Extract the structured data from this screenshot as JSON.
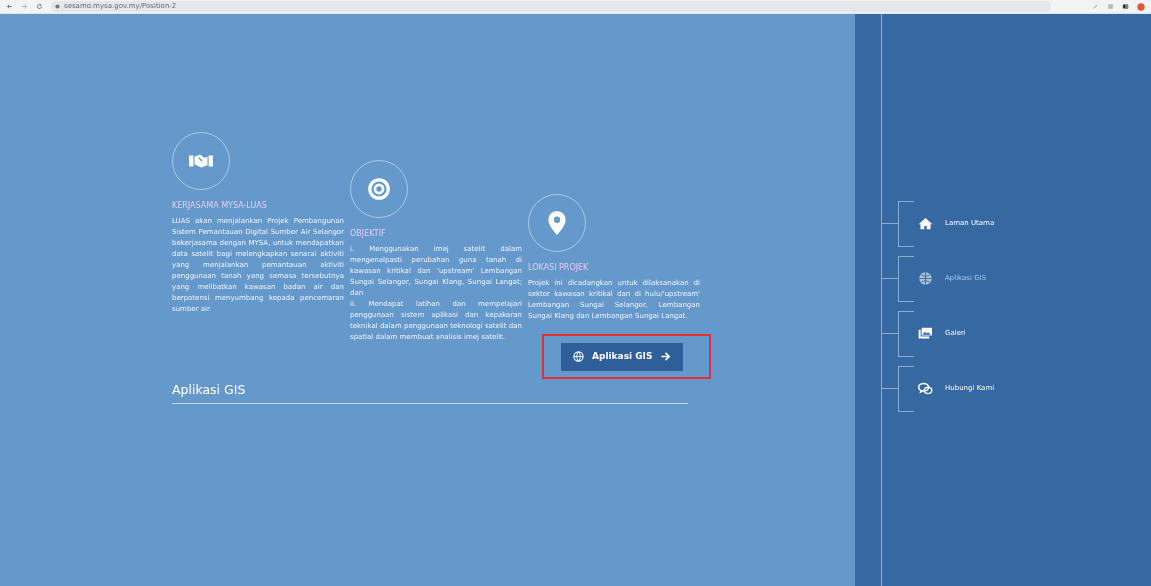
{
  "browser": {
    "url": "sesamo.mysa.gov.my/Position-2"
  },
  "sections": [
    {
      "kind": "handshake",
      "title": "KERJASAMA MYSA-LUAS",
      "paragraphs": [
        "LUAS akan menjalankan Projek Pembangunan Sistem Pemantauan Digital Sumber Air Selangor bekerjasama dengan MYSA, untuk mendapatkan data satelit bagi melengkapkan senarai aktiviti yang menjalankan pemantauan aktiviti penggunaan tanah yang semasa tersebutnya yang melibatkan kawasan badan air dan berpotensi menyumbang kepada pencemaran sumber air."
      ]
    },
    {
      "kind": "target",
      "title": "OBJEKTIF",
      "paragraphs": [
        "i. Menggunakan imej satelit dalam mengenalpasti perubahan guna tanah di kawasan kritikal dan 'upstream' Lembangan Sungai Selangor, Sungai Klang, Sungai Langat; dan",
        "ii. Mendapat latihan dan mempelajari penggunaan sistem aplikasi dan kepakaran teknikal dalam penggunaan teknologi satelit dan spatial dalam membuat analisis imej satelit."
      ]
    },
    {
      "kind": "pin",
      "title": "LOKASI PROJEK",
      "paragraphs": [
        "Projek ini dicadangkan untuk dilaksanakan di sektor kawasan kritikal dan di hulu/'upstream' Lembangan Sungai Selangor, Lembangan Sungai Klang dan Lembangan Sungai Langat."
      ]
    }
  ],
  "action_button": {
    "label": "Aplikasi GIS",
    "highlighted": true
  },
  "heading": "Aplikasi GIS",
  "sidebar": {
    "items": [
      {
        "kind": "home",
        "label": "Laman Utama",
        "selected": false
      },
      {
        "kind": "globe",
        "label": "Aplikasi GIS",
        "selected": true
      },
      {
        "kind": "gallery",
        "label": "Galeri",
        "selected": false
      },
      {
        "kind": "chat",
        "label": "Hubungi Kami",
        "selected": false
      }
    ]
  }
}
